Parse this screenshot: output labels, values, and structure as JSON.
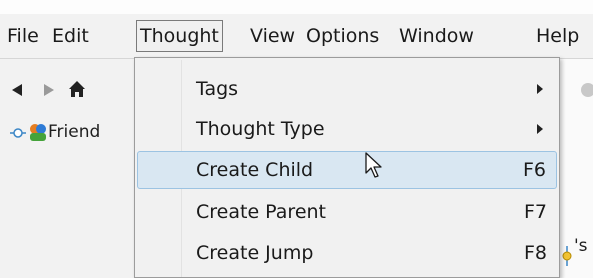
{
  "menubar": {
    "items": [
      {
        "label": "File"
      },
      {
        "label": "Edit"
      },
      {
        "label": "Thought"
      },
      {
        "label": "View"
      },
      {
        "label": "Options"
      },
      {
        "label": "Window"
      },
      {
        "label": "Help"
      }
    ]
  },
  "toolbar": {
    "back_icon": "back-arrow-icon",
    "forward_icon": "forward-arrow-icon",
    "home_icon": "home-icon"
  },
  "tree": {
    "item_label": "Friend"
  },
  "canvas": {
    "partial_label": "'s E"
  },
  "thought_menu": {
    "items": [
      {
        "label": "Tags",
        "shortcut": "",
        "submenu": true
      },
      {
        "label": "Thought Type",
        "shortcut": "",
        "submenu": true
      },
      {
        "label": "Create Child",
        "shortcut": "F6",
        "submenu": false,
        "highlighted": true
      },
      {
        "label": "Create Parent",
        "shortcut": "F7",
        "submenu": false
      },
      {
        "label": "Create Jump",
        "shortcut": "F8",
        "submenu": false
      }
    ]
  },
  "colors": {
    "highlight_bg": "#d9e7f2",
    "highlight_border": "#9cc3e2"
  }
}
